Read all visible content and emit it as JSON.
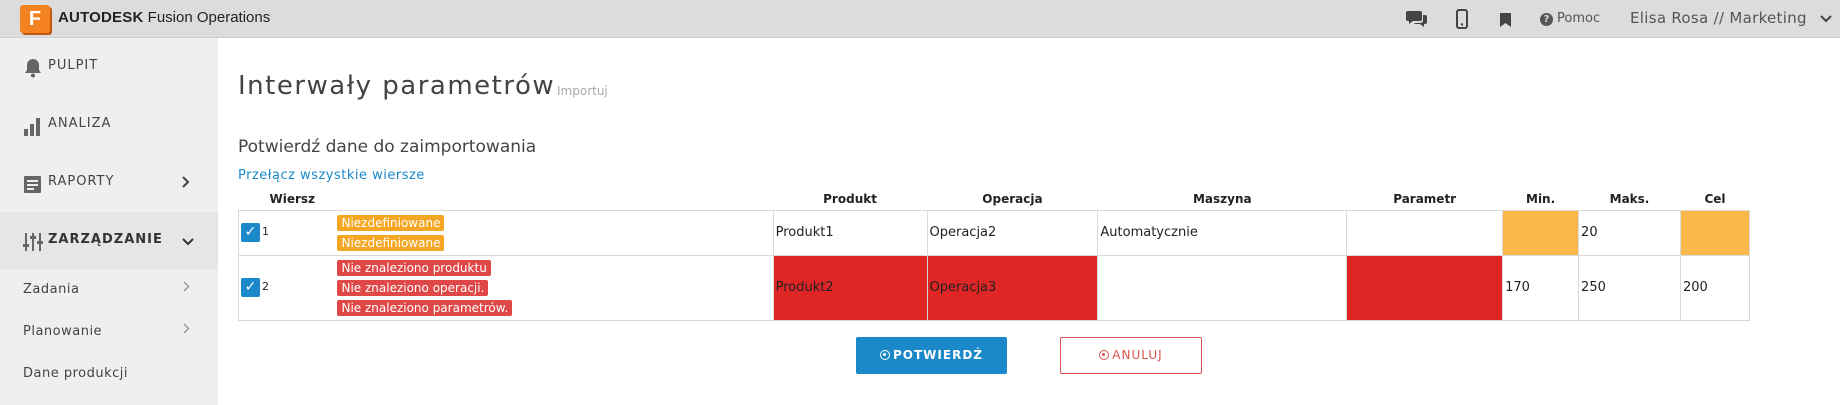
{
  "topbar": {
    "logo_letter": "F",
    "brand_bold": "AUTODESK",
    "brand_rest": "Fusion Operations",
    "help_label": "Pomoc",
    "user_label": "Elisa Rosa // Marketing",
    "chevron": "⌄"
  },
  "sidebar": {
    "items": [
      {
        "label": "PULPIT",
        "icon": "bell-icon"
      },
      {
        "label": "ANALIZA",
        "icon": "bar-chart-icon"
      },
      {
        "label": "RAPORTY",
        "icon": "report-icon",
        "chevron": "›"
      },
      {
        "label": "ZARZĄDZANIE",
        "icon": "sliders-icon",
        "chevron": "⌄"
      }
    ],
    "subitems": [
      {
        "label": "Zadania",
        "chevron": "›"
      },
      {
        "label": "Planowanie",
        "chevron": "›"
      },
      {
        "label": "Dane produkcji"
      }
    ]
  },
  "page": {
    "title": "Interwały parametrów",
    "title_sub": "Importuj",
    "subtitle": "Potwierdź dane do zaimportowania",
    "toggle_link": "Przełącz wszystkie wiersze"
  },
  "table": {
    "headers": [
      "Wiersz",
      "Produkt",
      "Operacja",
      "Maszyna",
      "Parametr",
      "Min.",
      "Maks.",
      "Cel"
    ],
    "rows": [
      {
        "num": "1",
        "checked": "✓",
        "badges": [
          "Niezdefiniowane",
          "Niezdefiniowane"
        ],
        "produkt": "Produkt1",
        "operacja": "Operacja2",
        "maszyna": "Automatycznie",
        "parametr": "",
        "min": "",
        "maks": "20",
        "cel": ""
      },
      {
        "num": "2",
        "checked": "✓",
        "badges": [
          "Nie znaleziono produktu",
          "Nie znaleziono operacji.",
          "Nie znaleziono parametrów."
        ],
        "produkt": "Produkt2",
        "operacja": "Operacja3",
        "maszyna": "",
        "parametr": "",
        "min": "170",
        "maks": "250",
        "cel": "200"
      }
    ]
  },
  "buttons": {
    "confirm": "POTWIERDŹ",
    "cancel": "ANULUJ"
  },
  "colors": {
    "accent": "#1a88c9",
    "error": "#e02525",
    "warning": "#fbb84a",
    "logo": "#f58220"
  }
}
